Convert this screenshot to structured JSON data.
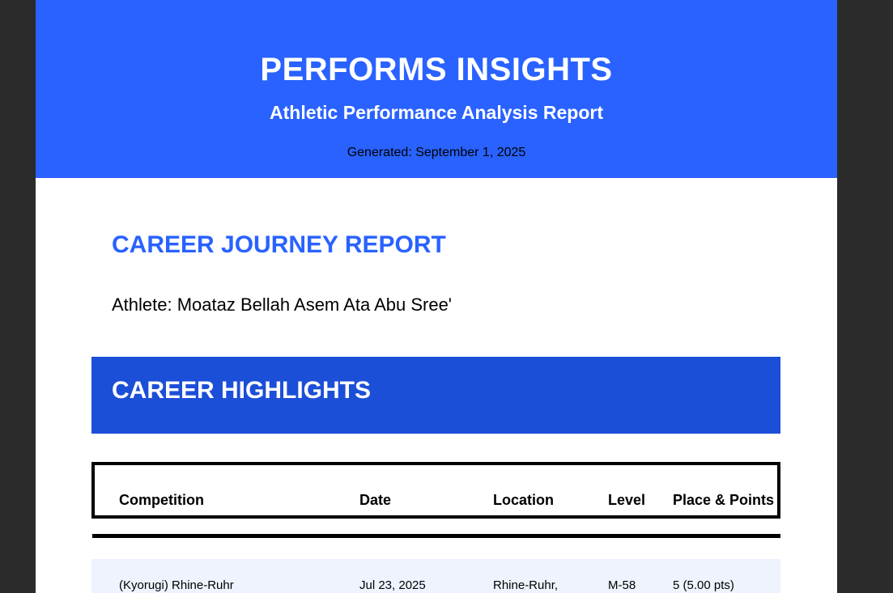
{
  "header": {
    "title": "PERFORMS INSIGHTS",
    "subtitle": "Athletic Performance Analysis Report",
    "generated": "Generated: September 1, 2025"
  },
  "report": {
    "title": "CAREER JOURNEY REPORT",
    "athlete": "Athlete: Moataz Bellah Asem Ata Abu Sree'"
  },
  "highlights": {
    "title": "CAREER HIGHLIGHTS",
    "columns": [
      "Competition",
      "Date",
      "Location",
      "Level",
      "Place & Points"
    ],
    "rows": [
      {
        "competition": "(Kyorugi) Rhine-Ruhr",
        "date": "Jul 23, 2025",
        "location": "Rhine-Ruhr,",
        "level": "M-58",
        "place": "5 (5.00 pts)"
      }
    ]
  },
  "colors": {
    "banner": "#2962ff",
    "section_bar": "#1c4fd8",
    "row_bg": "#eef3fd"
  }
}
